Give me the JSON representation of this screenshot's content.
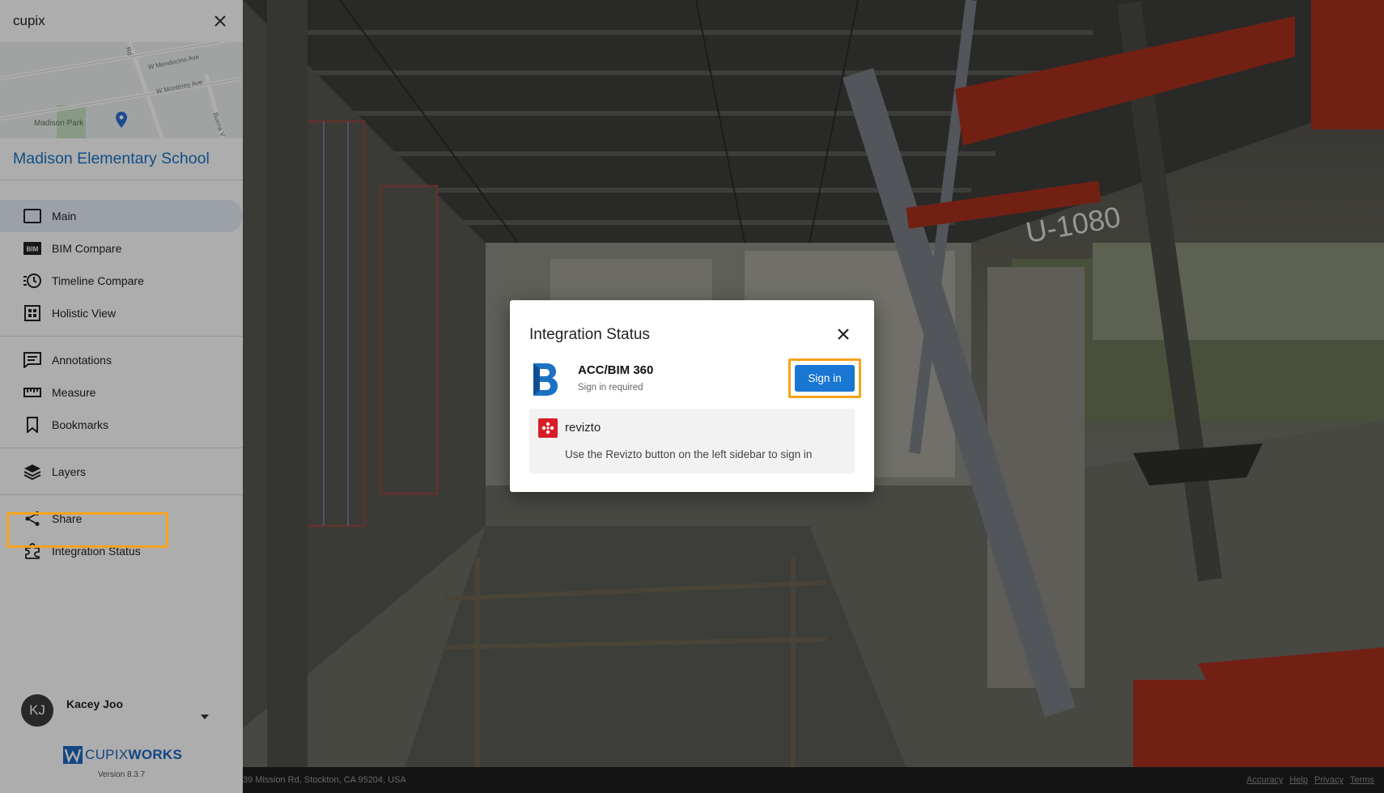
{
  "app": {
    "brand": "cupix"
  },
  "map": {
    "streets": [
      "W Mendocino Ave",
      "W Monterey Ave",
      "Rd",
      "Buena V"
    ],
    "park": "Madison Park"
  },
  "project": {
    "title": "Madison Elementary School"
  },
  "nav": {
    "group1": [
      {
        "label": "Main",
        "icon": "square-icon",
        "active": true
      },
      {
        "label": "BIM Compare",
        "icon": "bim-icon"
      },
      {
        "label": "Timeline Compare",
        "icon": "timeline-clock-icon"
      },
      {
        "label": "Holistic View",
        "icon": "grid-icon"
      }
    ],
    "group2": [
      {
        "label": "Annotations",
        "icon": "annotation-icon"
      },
      {
        "label": "Measure",
        "icon": "ruler-icon"
      },
      {
        "label": "Bookmarks",
        "icon": "bookmark-icon"
      }
    ],
    "group3": [
      {
        "label": "Layers",
        "icon": "layers-icon"
      }
    ],
    "group4": [
      {
        "label": "Share",
        "icon": "share-icon"
      },
      {
        "label": "Integration Status",
        "icon": "puzzle-icon"
      }
    ]
  },
  "user": {
    "initials": "KJ",
    "name": "Kacey Joo"
  },
  "footer": {
    "logo_bold": "CUPIX",
    "logo_rest": "WORKS",
    "version": "Version 8.3.7",
    "address": "39 Mission Rd, Stockton, CA 95204, USA",
    "links": [
      "Accuracy",
      "Help",
      "Privacy",
      "Terms"
    ]
  },
  "modal": {
    "title": "Integration Status",
    "acc": {
      "name": "ACC/BIM 360",
      "status": "Sign in required",
      "button": "Sign in"
    },
    "revizto": {
      "name": "revizto",
      "message": "Use the Revizto button on the left sidebar to sign in"
    }
  },
  "colors": {
    "accent": "#1a73c8",
    "button": "#1976d2",
    "highlight": "#f7a21b",
    "revizto": "#d71e28"
  }
}
